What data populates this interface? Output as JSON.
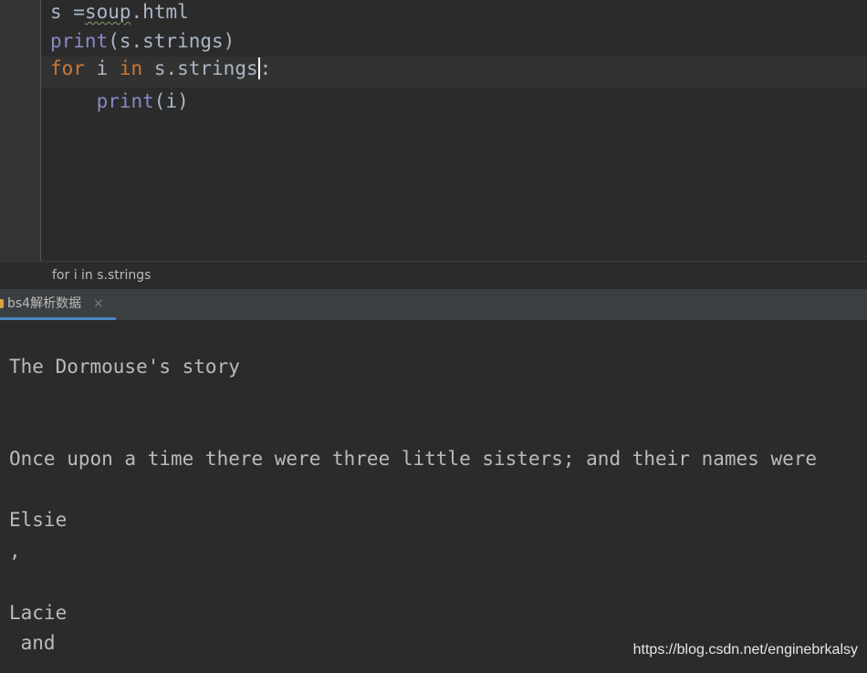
{
  "editor": {
    "line1": {
      "var": "s",
      "op": " =",
      "obj": "soup",
      "rest": ".html"
    },
    "line2": {
      "func": "print",
      "args": "(s.strings)"
    },
    "line3": {
      "kw_for": "for",
      "var": " i ",
      "kw_in": "in",
      "iter": " s.strings",
      "colon": ":"
    },
    "line4": {
      "indent": "    ",
      "func": "print",
      "args": "(i)"
    }
  },
  "breadcrumb": {
    "text": "for i in s.strings"
  },
  "run_panel": {
    "tab_label": "bs4解析数据",
    "close_glyph": "×",
    "icon": "python-run-icon"
  },
  "console": {
    "lines": [
      "The Dormouse's story",
      "Once upon a time there were three little sisters; and their names were",
      "Elsie",
      ",",
      "Lacie",
      " and"
    ]
  },
  "watermark": "https://blog.csdn.net/enginebrkalsy",
  "colors": {
    "background": "#2b2b2b",
    "keyword": "#cc7832",
    "builtin": "#8888c6",
    "text": "#a9b7c6",
    "tab_accent": "#4a88c7"
  }
}
